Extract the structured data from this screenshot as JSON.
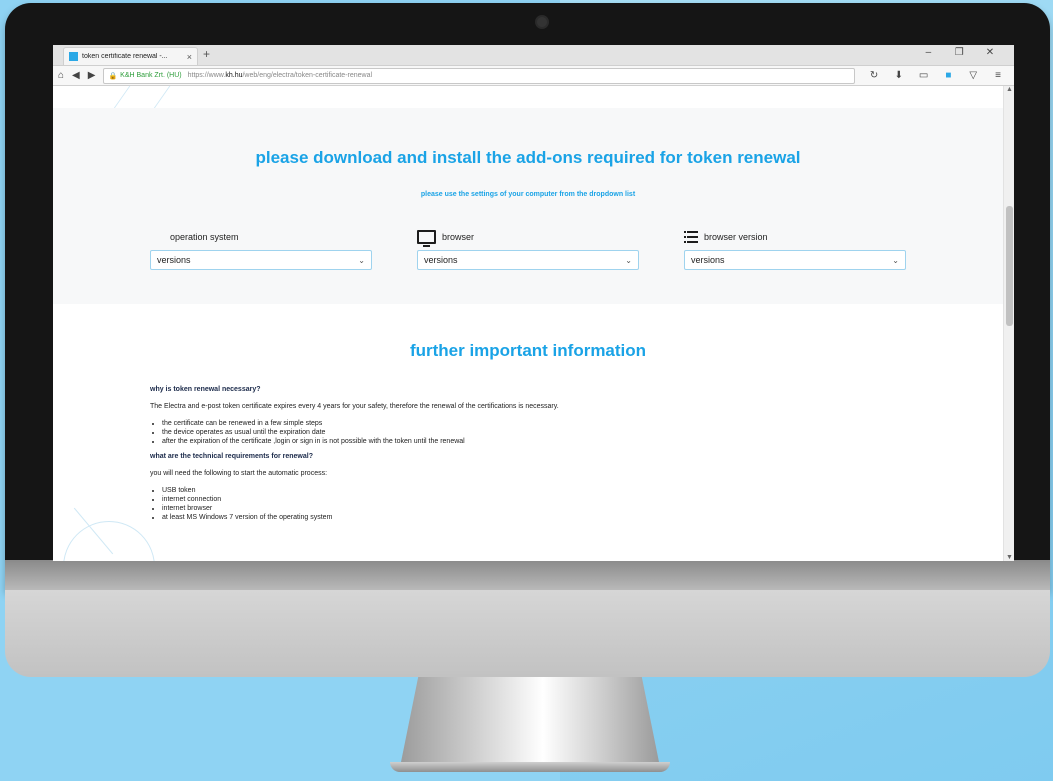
{
  "browser": {
    "tab_title": "token certificate renewal -...",
    "tab_close": "×",
    "new_tab": "+",
    "window_minimize": "–",
    "window_restore": "❐",
    "window_close": "✕",
    "site_identity": "K&H Bank Zrt. (HU)",
    "url_prefix": "https://www.",
    "url_host": "kh.hu",
    "url_path": "/web/eng/electra/token-certificate-renewal",
    "home_icon": "home-icon",
    "reload_icon": "reload-icon"
  },
  "download_section": {
    "title": "please download and install the add-ons required for token renewal",
    "subtitle": "please use the settings of your computer from the dropdown list",
    "columns": [
      {
        "label": "operation system",
        "icon": "windows-icon",
        "selected": "versions"
      },
      {
        "label": "browser",
        "icon": "monitor-icon",
        "selected": "versions"
      },
      {
        "label": "browser version",
        "icon": "list-icon",
        "selected": "versions"
      }
    ]
  },
  "info_section": {
    "title": "further important information",
    "q1": "why is token renewal necessary?",
    "p1": "The Electra and e-post token certificate expires every 4 years for your safety, therefore the renewal of the certifications is necessary.",
    "bullets1": [
      "the certificate can be renewed in a few simple steps",
      "the device operates as usual until the expiration date",
      "after the expiration of the certificate ,login or sign in is not possible with the token until the renewal"
    ],
    "q2": "what are the technical requirements for renewal?",
    "p2": "you will need the following to start the automatic process:",
    "bullets2": [
      "USB token",
      "internet connection",
      "internet browser",
      "at least MS Windows 7 version of the operating system"
    ]
  },
  "colors": {
    "accent": "#1aa3e6",
    "background": "#8fd3f3"
  }
}
